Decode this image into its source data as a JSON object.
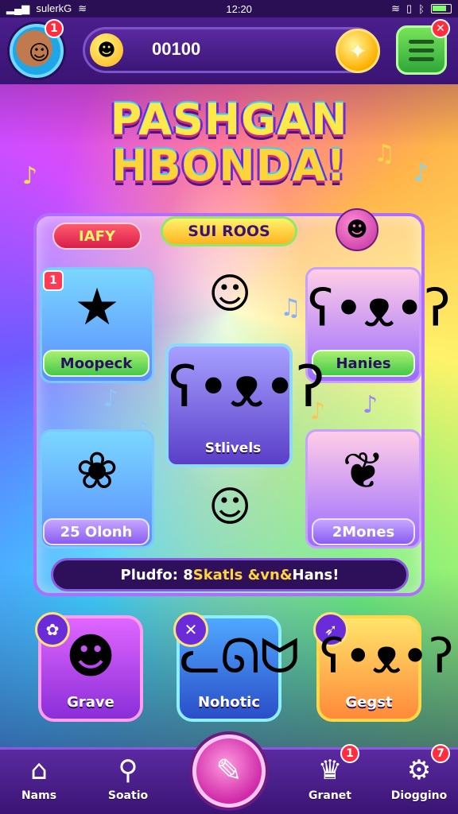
{
  "status_bar": {
    "carrier": "ꜱulerkG",
    "time": "12:20",
    "battery_label": "bat"
  },
  "top_bar": {
    "avatar_badge": "1",
    "coin_amount": "00100",
    "menu_badge": "✕"
  },
  "title": {
    "line1": "PASHGAN",
    "line2": "HBONDA!"
  },
  "panel": {
    "ribbon": "IAFY",
    "header": "SUI ROOS",
    "info_prefix": "Pludfo: 8 ",
    "info_highlight": "Skatls &vn&",
    "info_suffix": " Hans!"
  },
  "cards": {
    "top_left_label": "Moopeck",
    "top_left_badge": "1",
    "top_right_label": "Hanies",
    "bottom_left_label": "25 Olonh",
    "bottom_right_label": "2Mones",
    "center_label": "Stlivels"
  },
  "tiles": [
    {
      "label": "Grave"
    },
    {
      "label": "Nohotic"
    },
    {
      "label": "Gegst"
    }
  ],
  "nav": {
    "items": [
      {
        "label": "Nams",
        "badge": ""
      },
      {
        "label": "Soatio",
        "badge": ""
      },
      {
        "label": "Granet",
        "badge": "1"
      },
      {
        "label": "Dioggino",
        "badge": "7"
      }
    ]
  },
  "icons": {
    "avatar": "avatar-icon",
    "coin": "smiley-coin-icon",
    "star": "star-coin-icon",
    "menu": "menu-icon",
    "play": "play-icon"
  },
  "colors": {
    "accent": "#b26cff",
    "coin": "#ffb31a",
    "badge": "#ff2d3d"
  }
}
